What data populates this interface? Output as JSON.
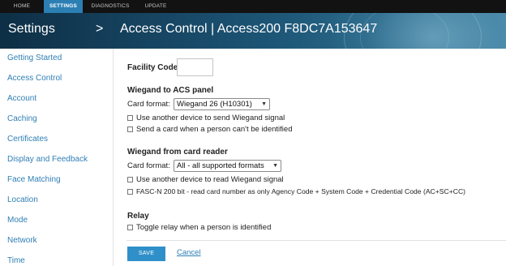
{
  "topnav": {
    "tabs": [
      {
        "label": "HOME"
      },
      {
        "label": "SETTINGS",
        "active": true
      },
      {
        "label": "DIAGNOSTICS"
      },
      {
        "label": "UPDATE"
      }
    ]
  },
  "header": {
    "section": "Settings",
    "chevron": ">",
    "title": "Access Control | Access200 F8DC7A153647"
  },
  "sidebar": {
    "items": [
      {
        "label": "Getting Started"
      },
      {
        "label": "Access Control"
      },
      {
        "label": "Account"
      },
      {
        "label": "Caching"
      },
      {
        "label": "Certificates"
      },
      {
        "label": "Display and Feedback"
      },
      {
        "label": "Face Matching"
      },
      {
        "label": "Location"
      },
      {
        "label": "Mode"
      },
      {
        "label": "Network"
      },
      {
        "label": "Time"
      }
    ]
  },
  "form": {
    "facility_code": {
      "label": "Facility Code",
      "value": ""
    },
    "wiegand_acs": {
      "heading": "Wiegand to ACS panel",
      "card_format_label": "Card format:",
      "card_format_value": "Wiegand 26 (H10301)",
      "options": [
        {
          "label": "Use another device to send Wiegand signal",
          "checked": false
        },
        {
          "label": "Send a card when a person can't be identified",
          "checked": false
        }
      ]
    },
    "wiegand_reader": {
      "heading": "Wiegand from card reader",
      "card_format_label": "Card format:",
      "card_format_value": "All - all supported formats",
      "options": [
        {
          "label": "Use another device to read Wiegand signal",
          "checked": false
        },
        {
          "label": "FASC-N 200 bit - read card number as only Agency Code + System Code + Credential Code (AC+SC+CC)",
          "checked": false
        }
      ]
    },
    "relay": {
      "heading": "Relay",
      "options": [
        {
          "label": "Toggle relay when a person is identified",
          "checked": false
        }
      ]
    },
    "save_label": "SAVE",
    "cancel_label": "Cancel"
  },
  "colors": {
    "nav_bg": "#121212",
    "active_tab": "#2b7fb3",
    "link": "#2f7fb5",
    "save_button": "#2f8fc9"
  }
}
